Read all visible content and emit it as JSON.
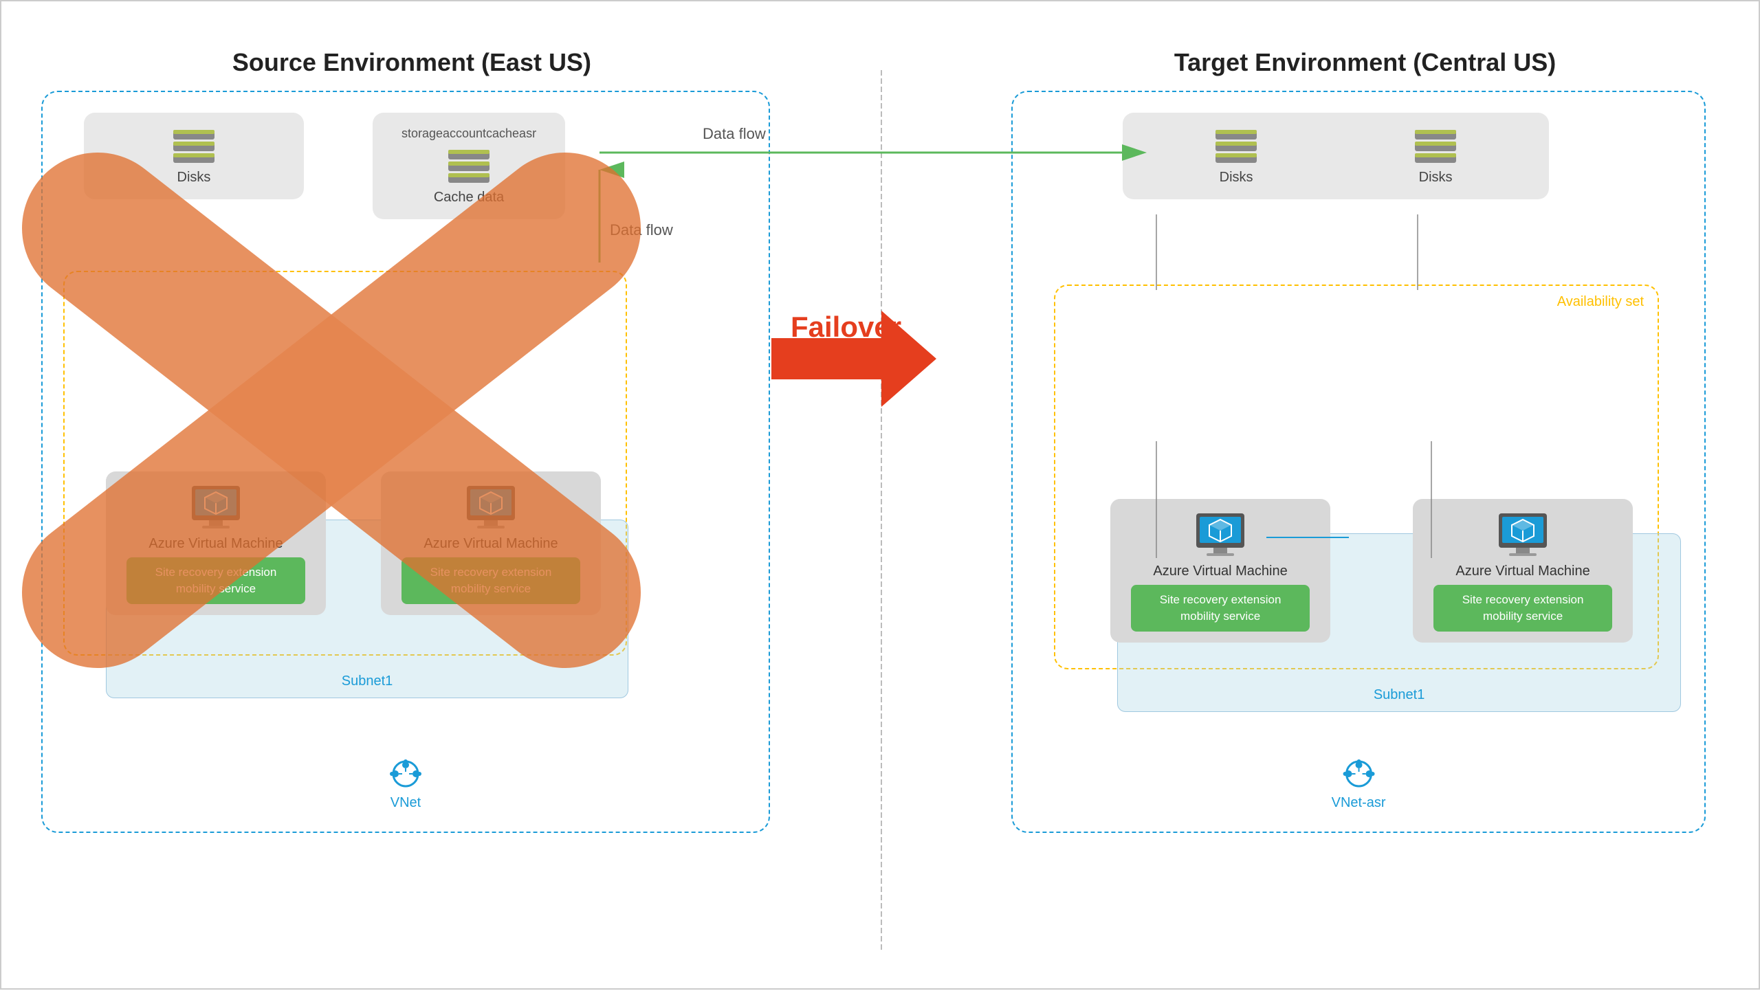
{
  "source": {
    "title": "Source Environment (East US)",
    "storage_account": {
      "name": "storageaccountcacheasr",
      "label": "Cache data"
    },
    "disks_label": "Disks",
    "vm1_label": "Azure Virtual Machine",
    "vm2_label": "Azure Virtual Machine",
    "site_recovery_label": "Site recovery extension mobility service",
    "subnet_label": "Subnet1",
    "vnet_label": "VNet"
  },
  "target": {
    "title": "Target Environment (Central US)",
    "disks_label1": "Disks",
    "disks_label2": "Disks",
    "vm1_label": "Azure Virtual Machine",
    "vm2_label": "Azure Virtual Machine",
    "site_recovery_label1": "Site recovery extension mobility service",
    "site_recovery_label2": "Site recovery extension mobility service",
    "subnet_label": "Subnet1",
    "vnet_label": "VNet-asr",
    "availability_label": "Availability set"
  },
  "middle": {
    "failover_label": "Failover",
    "data_flow_label1": "Data flow",
    "data_flow_label2": "Data flow"
  },
  "colors": {
    "source_border": "#1a9bd7",
    "target_border": "#1a9bd7",
    "availability_border": "#ffc000",
    "vm_group_border": "#ffc000",
    "site_recovery_green": "#5cb85c",
    "failover_red": "#e53e1e",
    "data_flow_green": "#5cb85c",
    "subnet_blue": "#add8e6"
  }
}
